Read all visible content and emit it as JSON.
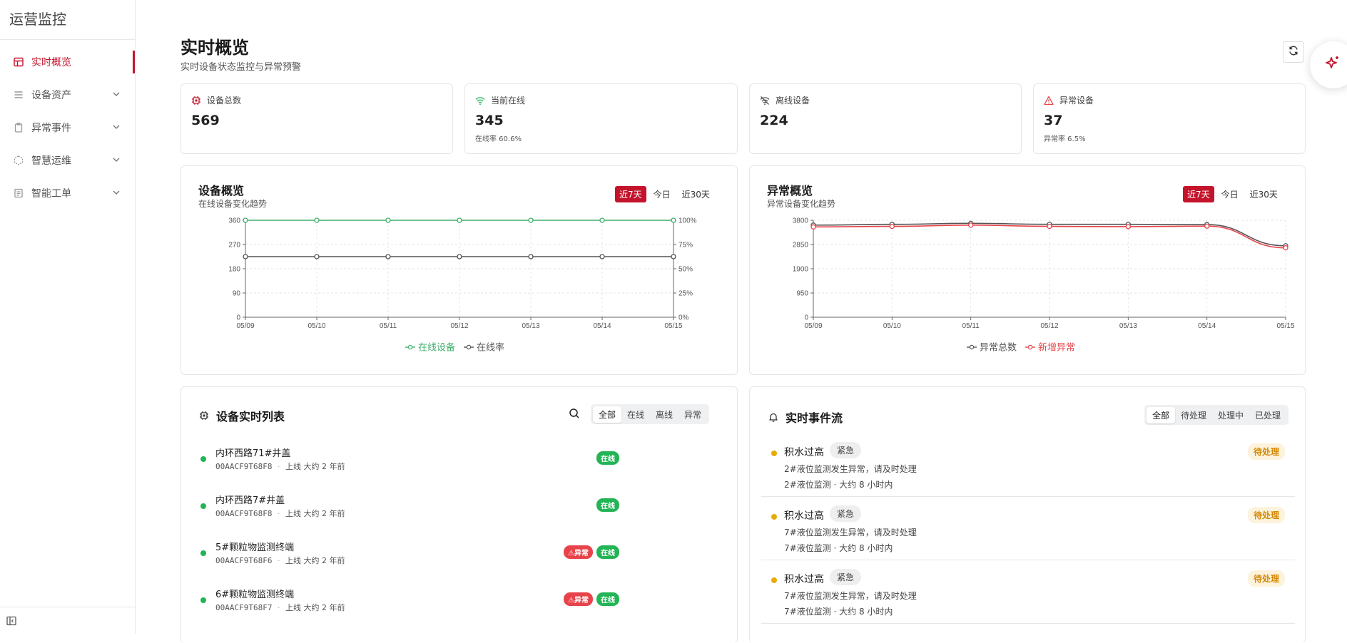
{
  "sidebar": {
    "brand": "运营监控",
    "items": [
      {
        "label": "实时概览",
        "icon": "dashboard-icon",
        "active": true
      },
      {
        "label": "设备资产",
        "icon": "list-icon"
      },
      {
        "label": "异常事件",
        "icon": "clipboard-icon"
      },
      {
        "label": "智慧运维",
        "icon": "hexagon-icon"
      },
      {
        "label": "智能工单",
        "icon": "document-icon"
      }
    ],
    "collapse_icon": "sidebar-toggle-icon"
  },
  "header": {
    "title": "实时概览",
    "subtitle": "实时设备状态监控与异常预警"
  },
  "stats": [
    {
      "label": "设备总数",
      "value": "569",
      "sub": "",
      "icon": "chip-icon",
      "color": "#c4142b"
    },
    {
      "label": "当前在线",
      "value": "345",
      "sub": "在线率 60.6%",
      "icon": "wifi-icon",
      "color": "#22b455"
    },
    {
      "label": "离线设备",
      "value": "224",
      "sub": "",
      "icon": "wifi-off-icon",
      "color": "#555555"
    },
    {
      "label": "异常设备",
      "value": "37",
      "sub": "异常率 6.5%",
      "icon": "warning-icon",
      "color": "#e8434a"
    }
  ],
  "device_chart": {
    "title": "设备概览",
    "subtitle": "在线设备变化趋势",
    "ranges": [
      "近7天",
      "今日",
      "近30天"
    ],
    "active_range": "近7天"
  },
  "anomaly_chart": {
    "title": "异常概览",
    "subtitle": "异常设备变化趋势",
    "ranges": [
      "近7天",
      "今日",
      "近30天"
    ],
    "active_range": "近7天"
  },
  "chart_data": [
    {
      "type": "line",
      "x": [
        "05/09",
        "05/10",
        "05/11",
        "05/12",
        "05/13",
        "05/14",
        "05/15"
      ],
      "ylim": [
        0,
        360
      ],
      "yticks": [
        "0",
        "90",
        "180",
        "270",
        "360"
      ],
      "y2lim": [
        0,
        100
      ],
      "y2ticks": [
        "0%",
        "25%",
        "50%",
        "75%",
        "100%"
      ],
      "series": [
        {
          "name": "在线设备",
          "axis": "left",
          "color": "#3fae6a",
          "values": [
            360,
            360,
            360,
            360,
            360,
            360,
            360
          ]
        },
        {
          "name": "在线率",
          "axis": "right",
          "color": "#555555",
          "values": [
            62.5,
            62.5,
            62.5,
            62.5,
            62.5,
            62.5,
            62.5
          ]
        }
      ],
      "grid": true,
      "legend": "bottom"
    },
    {
      "type": "line",
      "x": [
        "05/09",
        "05/10",
        "05/11",
        "05/12",
        "05/13",
        "05/14",
        "05/15"
      ],
      "ylim": [
        0,
        3800
      ],
      "yticks": [
        "0",
        "950",
        "1900",
        "2850",
        "3800"
      ],
      "series": [
        {
          "name": "异常总数",
          "color": "#555555",
          "values": [
            3610,
            3640,
            3680,
            3640,
            3640,
            3630,
            2800
          ]
        },
        {
          "name": "新增异常",
          "color": "#e8434a",
          "values": [
            3540,
            3560,
            3610,
            3560,
            3550,
            3570,
            2720
          ]
        }
      ],
      "grid": true,
      "legend": "bottom"
    }
  ],
  "devices": {
    "title": "设备实时列表",
    "tabs": [
      "全部",
      "在线",
      "离线",
      "异常"
    ],
    "active_tab": "全部",
    "rows": [
      {
        "name": "内环西路71#井盖",
        "code": "00AACF9T68F8",
        "sep": "·",
        "time": "上线 大约 2 年前",
        "abnormal": "",
        "status": "在线"
      },
      {
        "name": "内环西路7#井盖",
        "code": "00AACF9T68F8",
        "sep": "·",
        "time": "上线 大约 2 年前",
        "abnormal": "",
        "status": "在线"
      },
      {
        "name": "5#颗粒物监测终端",
        "code": "00AACF9T68F6",
        "sep": "·",
        "time": "上线 大约 2 年前",
        "abnormal": "⚠异常",
        "status": "在线"
      },
      {
        "name": "6#颗粒物监测终端",
        "code": "00AACF9T68F7",
        "sep": "·",
        "time": "上线 大约 2 年前",
        "abnormal": "⚠异常",
        "status": "在线"
      }
    ]
  },
  "events": {
    "title": "实时事件流",
    "tabs": [
      "全部",
      "待处理",
      "处理中",
      "已处理"
    ],
    "active_tab": "全部",
    "rows": [
      {
        "title": "积水过高",
        "level": "紧急",
        "desc": "2#液位监测发生异常，请及时处理",
        "meta": "2#液位监测 · 大约 8 小时内",
        "status": "待处理"
      },
      {
        "title": "积水过高",
        "level": "紧急",
        "desc": "7#液位监测发生异常，请及时处理",
        "meta": "7#液位监测 · 大约 8 小时内",
        "status": "待处理"
      },
      {
        "title": "积水过高",
        "level": "紧急",
        "desc": "7#液位监测发生异常，请及时处理",
        "meta": "7#液位监测 · 大约 8 小时内",
        "status": "待处理"
      }
    ]
  },
  "colors": {
    "accent": "#c4142b",
    "online": "#22b455",
    "danger": "#e8434a",
    "pending": "#d48806"
  }
}
